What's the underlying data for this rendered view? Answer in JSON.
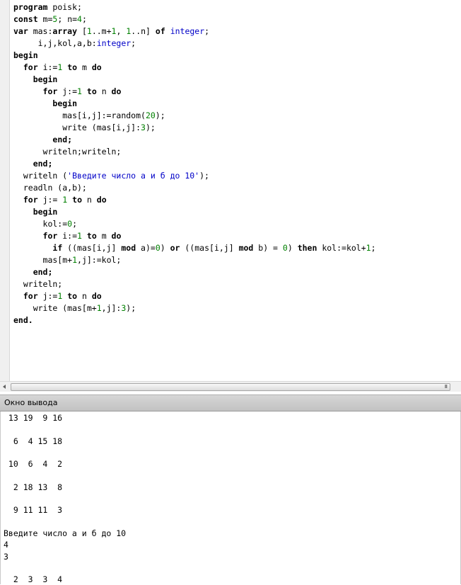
{
  "editor": {
    "code_lines": [
      [
        {
          "t": "program",
          "k": "kw"
        },
        {
          "t": " poisk;"
        }
      ],
      [
        {
          "t": "const",
          "k": "kw"
        },
        {
          "t": " m="
        },
        {
          "t": "5",
          "k": "num"
        },
        {
          "t": "; n="
        },
        {
          "t": "4",
          "k": "num"
        },
        {
          "t": ";"
        }
      ],
      [
        {
          "t": "var",
          "k": "kw"
        },
        {
          "t": " mas:"
        },
        {
          "t": "array",
          "k": "kw"
        },
        {
          "t": " ["
        },
        {
          "t": "1",
          "k": "num"
        },
        {
          "t": "..m+"
        },
        {
          "t": "1",
          "k": "num"
        },
        {
          "t": ", "
        },
        {
          "t": "1",
          "k": "num"
        },
        {
          "t": "..n] "
        },
        {
          "t": "of",
          "k": "kw"
        },
        {
          "t": " "
        },
        {
          "t": "integer",
          "k": "typ"
        },
        {
          "t": ";"
        }
      ],
      [
        {
          "t": "     i,j,kol,a,b:"
        },
        {
          "t": "integer",
          "k": "typ"
        },
        {
          "t": ";"
        }
      ],
      [
        {
          "t": "begin",
          "k": "kw"
        }
      ],
      [
        {
          "t": "  "
        },
        {
          "t": "for",
          "k": "kw"
        },
        {
          "t": " i:="
        },
        {
          "t": "1",
          "k": "num"
        },
        {
          "t": " "
        },
        {
          "t": "to",
          "k": "kw"
        },
        {
          "t": " m "
        },
        {
          "t": "do",
          "k": "kw"
        }
      ],
      [
        {
          "t": "    "
        },
        {
          "t": "begin",
          "k": "kw"
        }
      ],
      [
        {
          "t": "      "
        },
        {
          "t": "for",
          "k": "kw"
        },
        {
          "t": " j:="
        },
        {
          "t": "1",
          "k": "num"
        },
        {
          "t": " "
        },
        {
          "t": "to",
          "k": "kw"
        },
        {
          "t": " n "
        },
        {
          "t": "do",
          "k": "kw"
        }
      ],
      [
        {
          "t": "        "
        },
        {
          "t": "begin",
          "k": "kw"
        }
      ],
      [
        {
          "t": "          mas[i,j]:=random("
        },
        {
          "t": "20",
          "k": "num"
        },
        {
          "t": ");"
        }
      ],
      [
        {
          "t": "          write (mas[i,j]:"
        },
        {
          "t": "3",
          "k": "num"
        },
        {
          "t": ");"
        }
      ],
      [
        {
          "t": "        "
        },
        {
          "t": "end;",
          "k": "kw"
        }
      ],
      [
        {
          "t": "      writeln;writeln;"
        }
      ],
      [
        {
          "t": "    "
        },
        {
          "t": "end;",
          "k": "kw"
        }
      ],
      [
        {
          "t": "  writeln ("
        },
        {
          "t": "'Введите число а и б до 10'",
          "k": "str"
        },
        {
          "t": ");"
        }
      ],
      [
        {
          "t": "  readln (a,b);"
        }
      ],
      [
        {
          "t": "  "
        },
        {
          "t": "for",
          "k": "kw"
        },
        {
          "t": " j:= "
        },
        {
          "t": "1",
          "k": "num"
        },
        {
          "t": " "
        },
        {
          "t": "to",
          "k": "kw"
        },
        {
          "t": " n "
        },
        {
          "t": "do",
          "k": "kw"
        }
      ],
      [
        {
          "t": "    "
        },
        {
          "t": "begin",
          "k": "kw"
        }
      ],
      [
        {
          "t": "      kol:="
        },
        {
          "t": "0",
          "k": "num"
        },
        {
          "t": ";"
        }
      ],
      [
        {
          "t": "      "
        },
        {
          "t": "for",
          "k": "kw"
        },
        {
          "t": " i:="
        },
        {
          "t": "1",
          "k": "num"
        },
        {
          "t": " "
        },
        {
          "t": "to",
          "k": "kw"
        },
        {
          "t": " m "
        },
        {
          "t": "do",
          "k": "kw"
        }
      ],
      [
        {
          "t": "        "
        },
        {
          "t": "if",
          "k": "kw"
        },
        {
          "t": " ((mas[i,j] "
        },
        {
          "t": "mod",
          "k": "kw"
        },
        {
          "t": " a)="
        },
        {
          "t": "0",
          "k": "num"
        },
        {
          "t": ") "
        },
        {
          "t": "or",
          "k": "kw"
        },
        {
          "t": " ((mas[i,j] "
        },
        {
          "t": "mod",
          "k": "kw"
        },
        {
          "t": " b) = "
        },
        {
          "t": "0",
          "k": "num"
        },
        {
          "t": ") "
        },
        {
          "t": "then",
          "k": "kw"
        },
        {
          "t": " kol:=kol+"
        },
        {
          "t": "1",
          "k": "num"
        },
        {
          "t": ";"
        }
      ],
      [
        {
          "t": "      mas[m+"
        },
        {
          "t": "1",
          "k": "num"
        },
        {
          "t": ",j]:=kol;"
        }
      ],
      [
        {
          "t": "    "
        },
        {
          "t": "end;",
          "k": "kw"
        }
      ],
      [
        {
          "t": "  writeln;"
        }
      ],
      [
        {
          "t": "  "
        },
        {
          "t": "for",
          "k": "kw"
        },
        {
          "t": " j:="
        },
        {
          "t": "1",
          "k": "num"
        },
        {
          "t": " "
        },
        {
          "t": "to",
          "k": "kw"
        },
        {
          "t": " n "
        },
        {
          "t": "do",
          "k": "kw"
        }
      ],
      [
        {
          "t": "    write (mas[m+"
        },
        {
          "t": "1",
          "k": "num"
        },
        {
          "t": ",j]:"
        },
        {
          "t": "3",
          "k": "num"
        },
        {
          "t": ");"
        }
      ],
      [
        {
          "t": "end.",
          "k": "kw"
        }
      ]
    ]
  },
  "scrollbar": {
    "grip": "III"
  },
  "output": {
    "title": "Окно вывода",
    "lines": [
      " 13 19  9 16",
      "",
      "  6  4 15 18",
      "",
      " 10  6  4  2",
      "",
      "  2 18 13  8",
      "",
      "  9 11 11  3",
      "",
      "Введите число а и б до 10",
      "4",
      "3",
      "",
      "  2  3  3  4"
    ]
  },
  "colors": {
    "keyword": "#000000",
    "number": "#008000",
    "type": "#0000c8",
    "string": "#0000c8"
  }
}
